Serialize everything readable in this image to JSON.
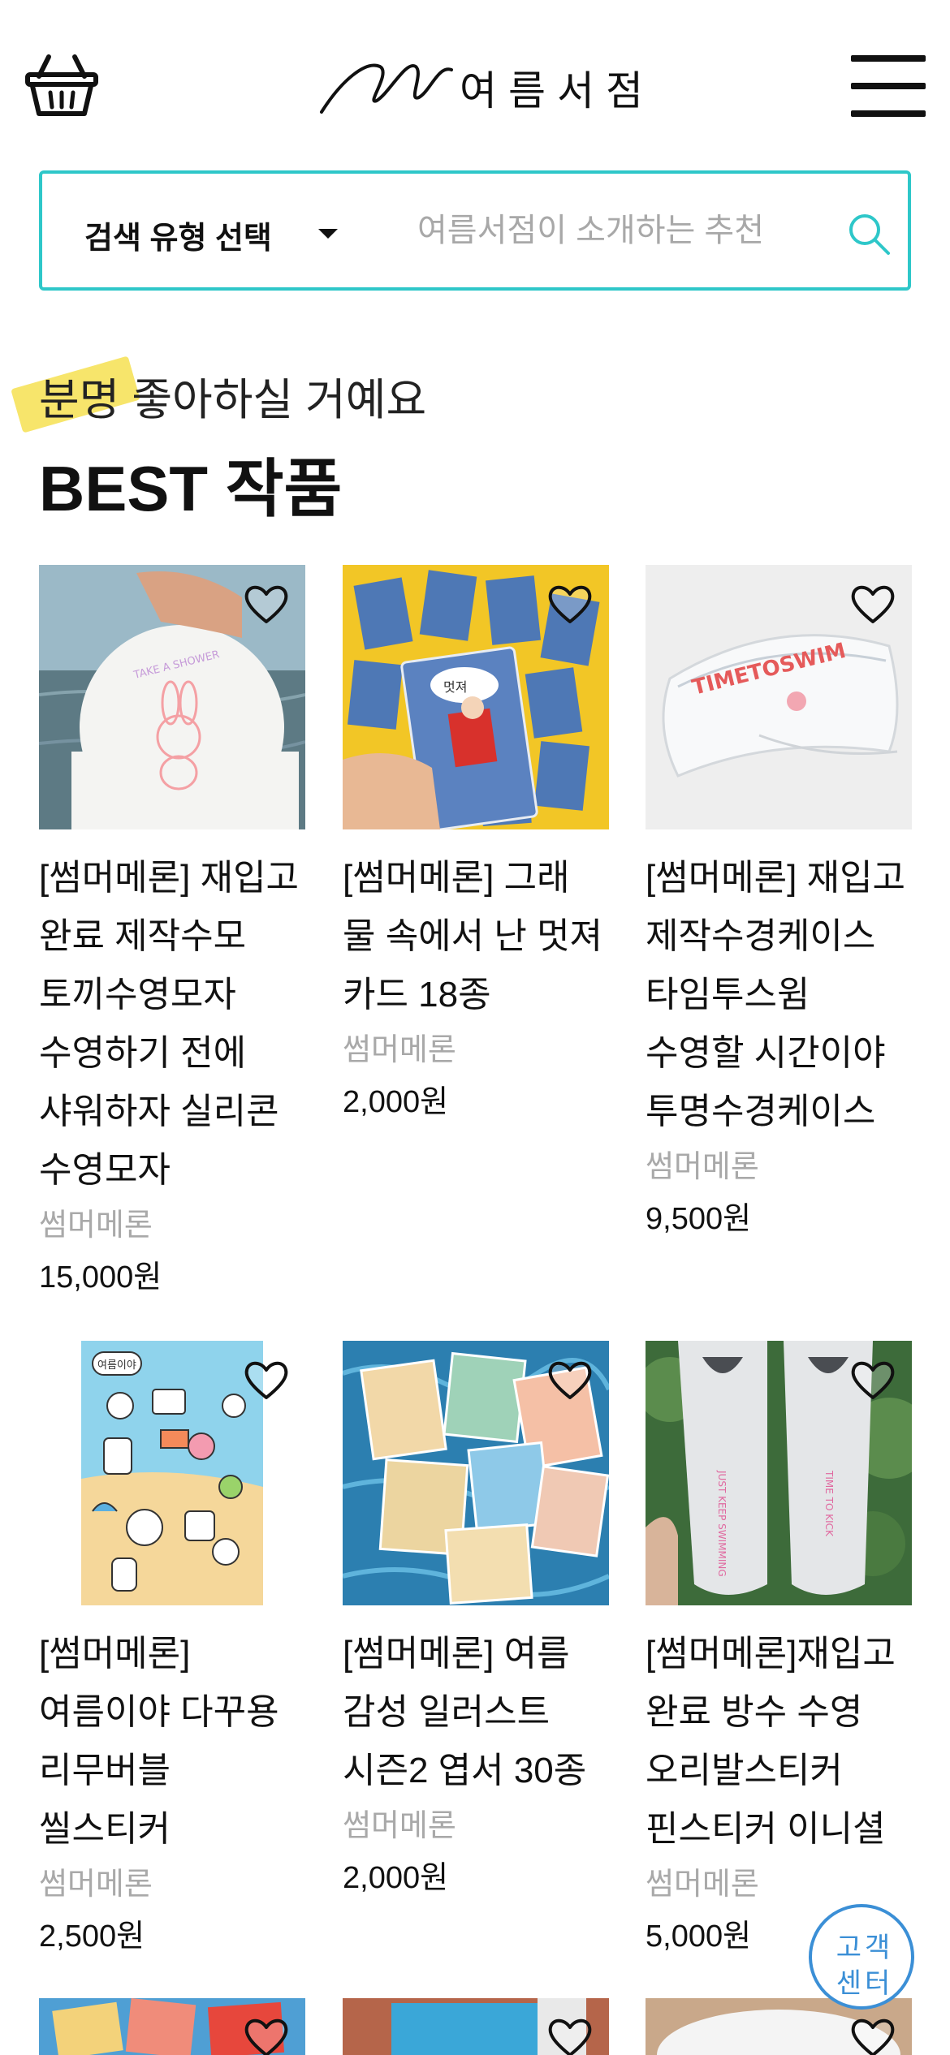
{
  "header": {
    "logo_text": "여름서점",
    "cart_icon": "basket-icon",
    "menu_icon": "hamburger-icon"
  },
  "search": {
    "type_label": "검색 유형 선택",
    "placeholder": "여름서점이 소개하는 추천",
    "icon": "search-icon",
    "accent_color": "#2ec7c9"
  },
  "section": {
    "subtitle": "분명 좋아하실 거예요",
    "title": "BEST 작품",
    "highlight_color": "#f7e463"
  },
  "products": [
    {
      "title": "[썸머메론] 재입고 완료 제작수모 토끼수영모자 수영하기 전에 샤워하자 실리콘 수영모자",
      "seller": "썸머메론",
      "price": "15,000원"
    },
    {
      "title": "[썸머메론] 그래 물 속에서 난 멋져 카드 18종",
      "seller": "썸머메론",
      "price": "2,000원"
    },
    {
      "title": "[썸머메론] 재입고 제작수경케이스 타임투스윔 수영할 시간이야 투명수경케이스",
      "seller": "썸머메론",
      "price": "9,500원"
    },
    {
      "title": "[썸머메론]여름이야 다꾸용 리무버블 씰스티커",
      "seller": "썸머메론",
      "price": "2,500원"
    },
    {
      "title": "[썸머메론] 여름 감성 일러스트 시즌2 엽서 30종",
      "seller": "썸머메론",
      "price": "2,000원"
    },
    {
      "title": "[썸머메론]재입고 완료 방수 수영 오리발스티커 핀스티커 이니셜",
      "seller": "썸머메론",
      "price": "5,000원"
    }
  ],
  "product_images": {
    "0": {
      "text": "TAKE A SHOWER"
    },
    "1": {
      "text": "멋져"
    },
    "2": {
      "text": "TIMETOSWIM"
    },
    "3": {
      "text": "여름이야"
    },
    "5": {
      "left": "JUST KEEP SWIMMING",
      "right": "TIME TO KICK"
    }
  },
  "cs_badge": {
    "line1": "고객",
    "line2": "센터"
  }
}
